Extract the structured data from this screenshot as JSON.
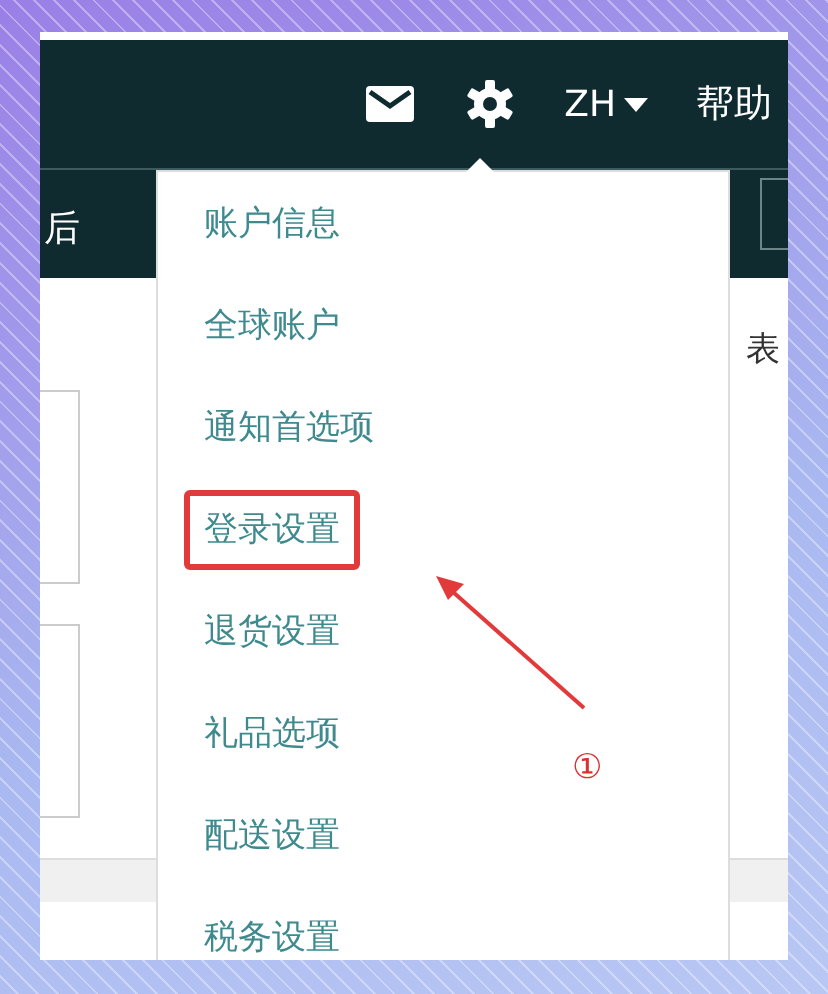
{
  "top_bar": {
    "language": "ZH",
    "help": "帮助",
    "left_text": "后"
  },
  "content": {
    "right_text": "表"
  },
  "settings_menu": {
    "items": [
      {
        "label": "账户信息",
        "highlighted": false
      },
      {
        "label": "全球账户",
        "highlighted": false
      },
      {
        "label": "通知首选项",
        "highlighted": false
      },
      {
        "label": "登录设置",
        "highlighted": true
      },
      {
        "label": "退货设置",
        "highlighted": false
      },
      {
        "label": "礼品选项",
        "highlighted": false
      },
      {
        "label": "配送设置",
        "highlighted": false
      },
      {
        "label": "税务设置",
        "highlighted": false
      }
    ]
  },
  "annotation": {
    "label": "①"
  }
}
